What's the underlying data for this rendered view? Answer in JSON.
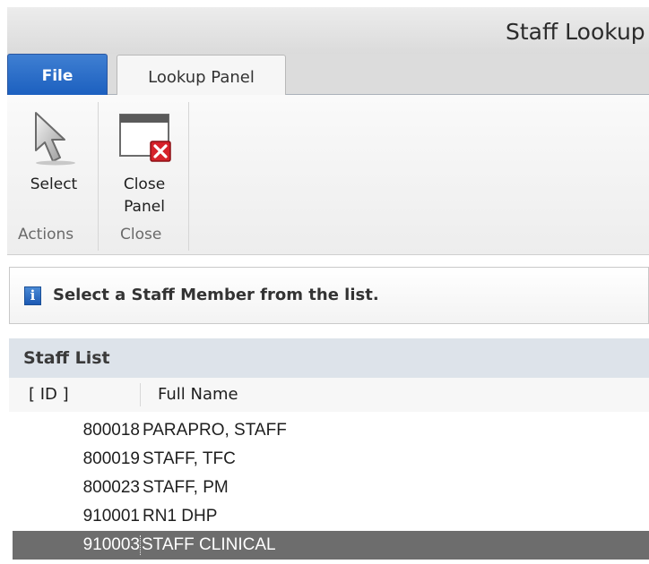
{
  "window": {
    "title": "Staff Lookup"
  },
  "tabs": {
    "file": "File",
    "lookup_panel": "Lookup Panel"
  },
  "ribbon": {
    "select_label": "Select",
    "close_panel_label_1": "Close",
    "close_panel_label_2": "Panel",
    "group_actions": "Actions",
    "group_close": "Close"
  },
  "info": {
    "message": "Select a Staff Member from the list.",
    "icon": "info-icon"
  },
  "staff_list": {
    "title": "Staff List",
    "columns": {
      "id": "[ ID ]",
      "name": "Full Name"
    },
    "rows": [
      {
        "id": "800018",
        "name": "PARAPRO, STAFF"
      },
      {
        "id": "800019",
        "name": "STAFF, TFC"
      },
      {
        "id": "800023",
        "name": "STAFF, PM"
      },
      {
        "id": "910001",
        "name": "RN1 DHP"
      },
      {
        "id": "910003",
        "name": "STAFF CLINICAL"
      }
    ],
    "selected_index": 4
  },
  "colors": {
    "file_tab": "#1b5fbf",
    "selection": "#6d6d6d",
    "list_header": "#dde3ea"
  }
}
